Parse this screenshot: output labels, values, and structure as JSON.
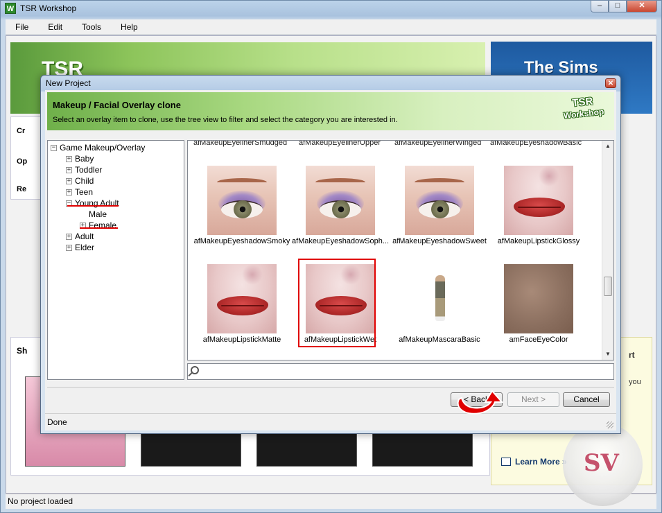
{
  "app": {
    "title": "TSR Workshop",
    "icon_letter": "W",
    "window_controls": [
      "minimize-icon",
      "maximize-icon",
      "close-icon"
    ]
  },
  "menu": [
    "File",
    "Edit",
    "Tools",
    "Help"
  ],
  "status": "No project loaded",
  "background": {
    "tsr_logo": "TSR",
    "sims_logo": "The Sims",
    "left_items": [
      "Cr",
      "Op",
      "Re"
    ],
    "bottom_left_heading": "Sh",
    "right_heading": "rt",
    "right_text": "you",
    "learn_more": "Learn More »",
    "watermark": "SV"
  },
  "dialog": {
    "title": "New Project",
    "header_title": "Makeup / Facial Overlay clone",
    "header_subtitle": "Select an overlay item to clone, use the tree view to filter and select the category you are interested in.",
    "header_logo_line1": "TSR",
    "header_logo_line2": "Workshop",
    "tree": {
      "root": "Game Makeup/Overlay",
      "items": [
        {
          "label": "Baby",
          "expander": "+",
          "level": 1
        },
        {
          "label": "Toddler",
          "expander": "+",
          "level": 1
        },
        {
          "label": "Child",
          "expander": "+",
          "level": 1
        },
        {
          "label": "Teen",
          "expander": "+",
          "level": 1
        },
        {
          "label": "Young Adult",
          "expander": "−",
          "level": 1,
          "highlighted": true
        },
        {
          "label": "Male",
          "expander": "",
          "level": 2
        },
        {
          "label": "Female",
          "expander": "+",
          "level": 2,
          "highlighted": true
        },
        {
          "label": "Adult",
          "expander": "+",
          "level": 1
        },
        {
          "label": "Elder",
          "expander": "+",
          "level": 1
        }
      ]
    },
    "cut_labels": [
      "afMakeupEyelinerSmudged",
      "afMakeupEyelinerUpper",
      "afMakeupEyelinerWinged",
      "afMakeupEyeshadowBasic"
    ],
    "items": [
      {
        "label": "afMakeupEyeshadowSmoky",
        "kind": "eye",
        "selected": false
      },
      {
        "label": "afMakeupEyeshadowSoph...",
        "kind": "eye",
        "selected": false
      },
      {
        "label": "afMakeupEyeshadowSweet",
        "kind": "eye",
        "selected": false
      },
      {
        "label": "afMakeupLipstickGlossy",
        "kind": "lip",
        "selected": false
      },
      {
        "label": "afMakeupLipstickMatte",
        "kind": "lip",
        "selected": false
      },
      {
        "label": "afMakeupLipstickWet",
        "kind": "lip",
        "selected": true
      },
      {
        "label": "afMakeupMascaraBasic",
        "kind": "sim",
        "selected": false
      },
      {
        "label": "amFaceEyeColor",
        "kind": "skin",
        "selected": false
      }
    ],
    "search_value": "",
    "buttons": {
      "back": "< Back",
      "next": "Next >",
      "cancel": "Cancel"
    },
    "status": "Done",
    "colors": {
      "highlight_red": "#e00000",
      "header_green": "#8cc45a"
    }
  }
}
